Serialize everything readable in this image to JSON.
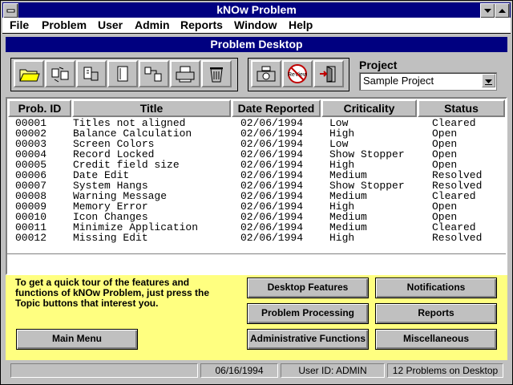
{
  "window": {
    "title": "kNOw Problem"
  },
  "menu": {
    "file": "File",
    "problem": "Problem",
    "user": "User",
    "admin": "Admin",
    "reports": "Reports",
    "window": "Window",
    "help": "Help"
  },
  "child": {
    "title": "Problem Desktop"
  },
  "toolbar": {
    "project_label": "Project",
    "project_value": "Sample Project",
    "icons": [
      "open-folder-icon",
      "exchange-icon",
      "transfer-icon",
      "notebook-icon",
      "share-icon",
      "printer-icon",
      "trash-icon",
      "camera-icon",
      "no-review-icon",
      "exit-door-icon"
    ],
    "no_review_text": "ReView"
  },
  "grid": {
    "headers": {
      "id": "Prob. ID",
      "title": "Title",
      "date": "Date Reported",
      "crit": "Criticality",
      "status": "Status"
    },
    "rows": [
      {
        "id": "00001",
        "title": "Titles not aligned",
        "date": "02/06/1994",
        "crit": "Low",
        "status": "Cleared"
      },
      {
        "id": "00002",
        "title": "Balance Calculation",
        "date": "02/06/1994",
        "crit": "High",
        "status": "Open"
      },
      {
        "id": "00003",
        "title": "Screen Colors",
        "date": "02/06/1994",
        "crit": "Low",
        "status": "Open"
      },
      {
        "id": "00004",
        "title": "Record Locked",
        "date": "02/06/1994",
        "crit": "Show Stopper",
        "status": "Open"
      },
      {
        "id": "00005",
        "title": "Credit field size",
        "date": "02/06/1994",
        "crit": "High",
        "status": "Open"
      },
      {
        "id": "00006",
        "title": "Date Edit",
        "date": "02/06/1994",
        "crit": "Medium",
        "status": "Resolved"
      },
      {
        "id": "00007",
        "title": "System Hangs",
        "date": "02/06/1994",
        "crit": "Show Stopper",
        "status": "Resolved"
      },
      {
        "id": "00008",
        "title": "Warning Message",
        "date": "02/06/1994",
        "crit": "Medium",
        "status": "Cleared"
      },
      {
        "id": "00009",
        "title": "Memory Error",
        "date": "02/06/1994",
        "crit": "High",
        "status": "Open"
      },
      {
        "id": "00010",
        "title": "Icon Changes",
        "date": "02/06/1994",
        "crit": "Medium",
        "status": "Open"
      },
      {
        "id": "00011",
        "title": "Minimize Application",
        "date": "02/06/1994",
        "crit": "Medium",
        "status": "Cleared"
      },
      {
        "id": "00012",
        "title": "Missing Edit",
        "date": "02/06/1994",
        "crit": "High",
        "status": "Resolved"
      }
    ]
  },
  "tour": {
    "text": "To get a quick tour of the features and functions of kNOw Problem, just press the Topic buttons that interest you."
  },
  "buttons": {
    "main_menu": "Main Menu",
    "desktop_features": "Desktop Features",
    "notifications": "Notifications",
    "problem_processing": "Problem Processing",
    "reports": "Reports",
    "admin_functions": "Administrative Functions",
    "miscellaneous": "Miscellaneous"
  },
  "status": {
    "blank": "",
    "date": "06/16/1994",
    "user": "User ID: ADMIN",
    "count": "12 Problems on Desktop"
  },
  "colors": {
    "title_bg": "#000080",
    "tour_bg": "#ffff80",
    "face": "#c0c0c0"
  }
}
